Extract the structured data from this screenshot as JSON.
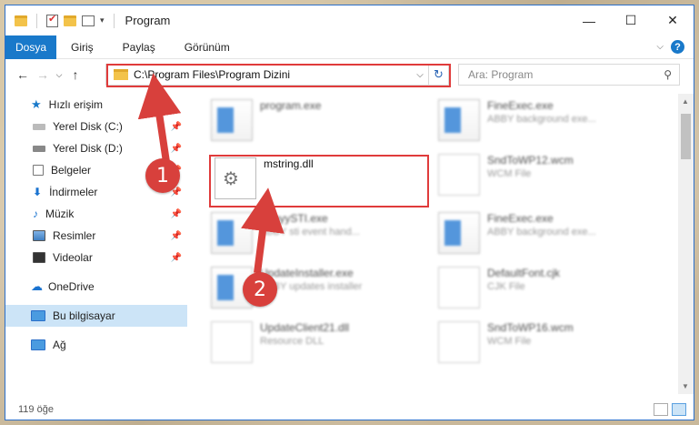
{
  "window": {
    "title": "Program"
  },
  "ribbon": {
    "tabs": [
      "Dosya",
      "Giriş",
      "Paylaş",
      "Görünüm"
    ]
  },
  "address": {
    "path": "C:\\Program Files\\Program Dizini"
  },
  "search": {
    "placeholder": "Ara: Program"
  },
  "sidebar": {
    "quick_access": "Hızlı erişim",
    "items": [
      {
        "label": "Yerel Disk (C:)",
        "icon": "drive-icon",
        "pinned": true
      },
      {
        "label": "Yerel Disk (D:)",
        "icon": "drive-icon",
        "pinned": true
      },
      {
        "label": "Belgeler",
        "icon": "documents-icon",
        "pinned": true
      },
      {
        "label": "İndirmeler",
        "icon": "download-icon",
        "pinned": true
      },
      {
        "label": "Müzik",
        "icon": "music-icon",
        "pinned": true
      },
      {
        "label": "Resimler",
        "icon": "pictures-icon",
        "pinned": true
      },
      {
        "label": "Videolar",
        "icon": "videos-icon",
        "pinned": true
      }
    ],
    "onedrive": "OneDrive",
    "this_pc": "Bu bilgisayar",
    "network": "Ağ"
  },
  "files": [
    {
      "name": "program.exe",
      "desc": "",
      "type": "exe"
    },
    {
      "name": "FineExec.exe",
      "desc": "ABBY background exe...",
      "type": "exe"
    },
    {
      "name": "mstring.dll",
      "desc": "",
      "type": "dll"
    },
    {
      "name": "SndToWP12.wcm",
      "desc": "WCM File",
      "type": "doc"
    },
    {
      "name": "AbbyySTI.exe",
      "desc": "ABBY sti event hand...",
      "type": "exe"
    },
    {
      "name": "FineExec.exe",
      "desc": "ABBY background exe...",
      "type": "exe"
    },
    {
      "name": "UpdateInstaller.exe",
      "desc": "ABBY updates installer",
      "type": "exe"
    },
    {
      "name": "DefaultFont.cjk",
      "desc": "CJK File",
      "type": "doc"
    },
    {
      "name": "UpdateClient21.dll",
      "desc": "Resource DLL",
      "type": "dll"
    },
    {
      "name": "SndToWP16.wcm",
      "desc": "WCM File",
      "type": "doc"
    }
  ],
  "status": {
    "count": "119 öğe"
  },
  "annotations": {
    "step1": "1",
    "step2": "2"
  },
  "colors": {
    "accent": "#1979ca",
    "highlight": "#e03b3b",
    "badge": "#d8403c"
  }
}
